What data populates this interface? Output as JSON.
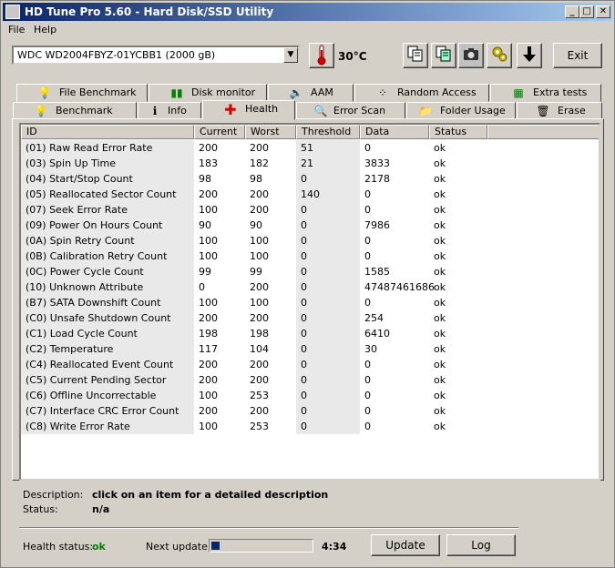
{
  "window": {
    "title": "HD Tune Pro 5.60 - Hard Disk/SSD Utility",
    "controls": {
      "minimize": "_",
      "maximize": "□",
      "close": "✕"
    }
  },
  "menu": {
    "file": "File",
    "help": "Help"
  },
  "toolbar": {
    "drive": "WDC WD2004FBYZ-01YCBB1 (2000 gB)",
    "temperature": "30°C",
    "exit_label": "Exit"
  },
  "tabs_top": [
    {
      "label": "File Benchmark"
    },
    {
      "label": "Disk monitor"
    },
    {
      "label": "AAM"
    },
    {
      "label": "Random Access"
    },
    {
      "label": "Extra tests"
    }
  ],
  "tabs_bottom": [
    {
      "label": "Benchmark"
    },
    {
      "label": "Info"
    },
    {
      "label": "Health"
    },
    {
      "label": "Error Scan"
    },
    {
      "label": "Folder Usage"
    },
    {
      "label": "Erase"
    }
  ],
  "columns": [
    "ID",
    "Current",
    "Worst",
    "Threshold",
    "Data",
    "Status"
  ],
  "rows": [
    [
      "(01) Raw Read Error Rate",
      "200",
      "200",
      "51",
      "0",
      "ok"
    ],
    [
      "(03) Spin Up Time",
      "183",
      "182",
      "21",
      "3833",
      "ok"
    ],
    [
      "(04) Start/Stop Count",
      "98",
      "98",
      "0",
      "2178",
      "ok"
    ],
    [
      "(05) Reallocated Sector Count",
      "200",
      "200",
      "140",
      "0",
      "ok"
    ],
    [
      "(07) Seek Error Rate",
      "100",
      "200",
      "0",
      "0",
      "ok"
    ],
    [
      "(09) Power On Hours Count",
      "90",
      "90",
      "0",
      "7986",
      "ok"
    ],
    [
      "(0A) Spin Retry Count",
      "100",
      "100",
      "0",
      "0",
      "ok"
    ],
    [
      "(0B) Calibration Retry Count",
      "100",
      "100",
      "0",
      "0",
      "ok"
    ],
    [
      "(0C) Power Cycle Count",
      "99",
      "99",
      "0",
      "1585",
      "ok"
    ],
    [
      "(10) Unknown Attribute",
      "0",
      "200",
      "0",
      "47487461686",
      "ok"
    ],
    [
      "(B7) SATA Downshift Count",
      "100",
      "100",
      "0",
      "0",
      "ok"
    ],
    [
      "(C0) Unsafe Shutdown Count",
      "200",
      "200",
      "0",
      "254",
      "ok"
    ],
    [
      "(C1) Load Cycle Count",
      "198",
      "198",
      "0",
      "6410",
      "ok"
    ],
    [
      "(C2) Temperature",
      "117",
      "104",
      "0",
      "30",
      "ok"
    ],
    [
      "(C4) Reallocated Event Count",
      "200",
      "200",
      "0",
      "0",
      "ok"
    ],
    [
      "(C5) Current Pending Sector",
      "200",
      "200",
      "0",
      "0",
      "ok"
    ],
    [
      "(C6) Offline Uncorrectable",
      "100",
      "253",
      "0",
      "0",
      "ok"
    ],
    [
      "(C7) Interface CRC Error Count",
      "200",
      "200",
      "0",
      "0",
      "ok"
    ],
    [
      "(C8) Write Error Rate",
      "100",
      "253",
      "0",
      "0",
      "ok"
    ]
  ],
  "details": {
    "description_label": "Description:",
    "description_value": "click on an item for a detailed description",
    "status_label": "Status:",
    "status_value": "n/a"
  },
  "footer": {
    "health_label": "Health status:",
    "health_value": "ok",
    "next_update_label": "Next update:",
    "progress": 0.08,
    "countdown": "4:34",
    "update_label": "Update",
    "log_label": "Log"
  },
  "colors": {
    "titlebar": "#0a246a",
    "ok_green": "#008000",
    "progress_fill": "#0a246a"
  }
}
